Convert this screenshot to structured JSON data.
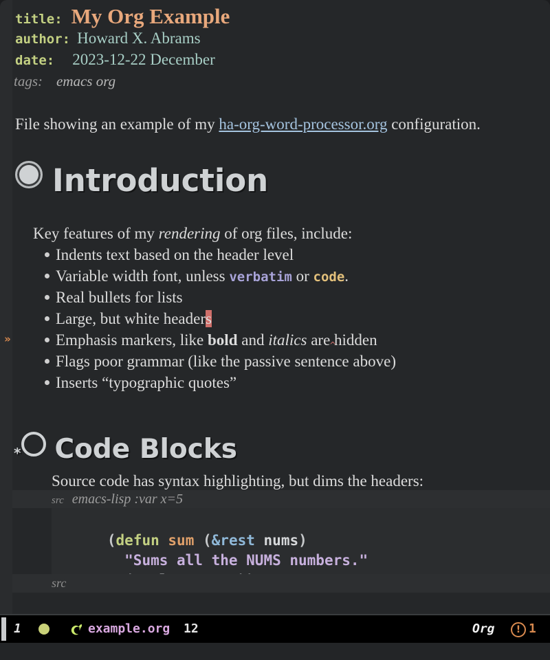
{
  "document": {
    "keywords": [
      {
        "key": "title:",
        "value": "My Org Example"
      },
      {
        "key": "author:",
        "value": "Howard X. Abrams"
      },
      {
        "key": "date:",
        "value": "2023-12-22 December"
      },
      {
        "key": "tags:",
        "value": "emacs org"
      }
    ],
    "intro": {
      "before": "File showing an example of my ",
      "link": "ha-org-word-processor.org",
      "after": " configuration."
    },
    "sections": [
      {
        "heading": "Introduction",
        "lead": {
          "before": "Key features of my ",
          "italic": "rendering",
          "after": " of org files, include:"
        },
        "items": [
          {
            "text": "Indents text based on the header level"
          },
          {
            "text": "Variable width font, unless ",
            "verbatim": "verbatim",
            "mid": " or ",
            "code": "code",
            "tail": "."
          },
          {
            "text": "Real bullets for lists"
          },
          {
            "text": "Large, but white header",
            "cursor": "s"
          },
          {
            "text": "Emphasis markers, like ",
            "bold": "bold",
            "mid": " and ",
            "italic": "italics",
            "tail": " are hidden"
          },
          {
            "text": "Flags poor grammar (like the passive sentence above)"
          },
          {
            "text": "Inserts “typographic quotes”"
          }
        ]
      },
      {
        "heading": "Code Blocks",
        "lead": "Source code has syntax highlighting, but dims the headers:",
        "src_begin_tag": "src",
        "src_begin_args": "emacs-lisp :var x=5",
        "src_end_tag": "src",
        "code_lines": [
          {
            "indent": "  ",
            "tokens": [
              {
                "t": "(",
                "c": "c-paren"
              },
              {
                "t": "defun",
                "c": "c-kw"
              },
              {
                "t": " ",
                "c": "c-var"
              },
              {
                "t": "sum",
                "c": "c-fn"
              },
              {
                "t": " ",
                "c": "c-var"
              },
              {
                "t": "(",
                "c": "c-paren"
              },
              {
                "t": "&rest",
                "c": "c-builtin"
              },
              {
                "t": " ",
                "c": "c-var"
              },
              {
                "t": "nums",
                "c": "c-var"
              },
              {
                "t": ")",
                "c": "c-paren"
              }
            ]
          },
          {
            "indent": "    ",
            "tokens": [
              {
                "t": "\"Sums all the NUMS numbers.\"",
                "c": "c-str"
              }
            ]
          },
          {
            "indent": "    ",
            "tokens": [
              {
                "t": "(",
                "c": "c-paren"
              },
              {
                "t": "apply",
                "c": "c-var"
              },
              {
                "t": " ",
                "c": "c-var"
              },
              {
                "t": "'+",
                "c": "c-var"
              },
              {
                "t": " ",
                "c": "c-var"
              },
              {
                "t": "num",
                "c": "c-var"
              },
              {
                "t": "))",
                "c": "c-paren"
              }
            ]
          }
        ]
      }
    ],
    "fringe_marker": "»"
  },
  "modeline": {
    "window_number": "1",
    "status_dot": "status-circle",
    "major_mode_icon": "gnu-icon",
    "buffer_name": "example.org",
    "column": "12",
    "major_mode": "Org",
    "warning_icon": "!",
    "warning_count": "1"
  },
  "colors": {
    "background": "#232527",
    "buffer_bg": "#252729",
    "fringe": "#2a2c2e",
    "keyword": "#c3d082",
    "title": "#e8a87c",
    "value": "#a8cfc6",
    "link": "#a5c4e0",
    "heading": "#cfd2d4",
    "cursor": "#cf6f6a",
    "verbatim": "#a8a3d8",
    "code": "#e3c07b",
    "modeline_bg": "#000000",
    "modeline_file": "#d9a8e0",
    "warning": "#d98a4f",
    "status_dot": "#c9d178"
  }
}
